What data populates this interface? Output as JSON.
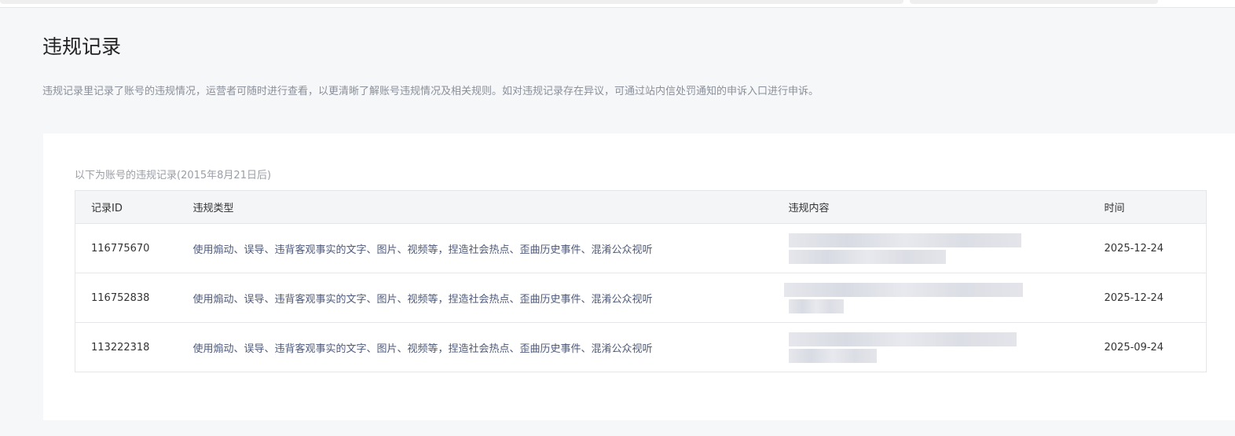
{
  "page": {
    "title": "违规记录",
    "description": "违规记录里记录了账号的违规情况，运营者可随时进行查看，以更清晰了解账号违规情况及相关规则。如对违规记录存在异议，可通过站内信处罚通知的申诉入口进行申诉。"
  },
  "card": {
    "subtitle": "以下为账号的违规记录(2015年8月21日后)"
  },
  "table": {
    "headers": [
      "记录ID",
      "违规类型",
      "违规内容",
      "时间"
    ],
    "rows": [
      {
        "id": "116775670",
        "type": "使用煽动、误导、违背客观事实的文字、图片、视频等，捏造社会热点、歪曲历史事件、混淆公众视听",
        "time": "2025-12-24"
      },
      {
        "id": "116752838",
        "type": "使用煽动、误导、违背客观事实的文字、图片、视频等，捏造社会热点、歪曲历史事件、混淆公众视听",
        "time": "2025-12-24"
      },
      {
        "id": "113222318",
        "type": "使用煽动、误导、违背客观事实的文字、图片、视频等，捏造社会热点、歪曲历史事件、混淆公众视听",
        "time": "2025-09-24"
      }
    ]
  }
}
